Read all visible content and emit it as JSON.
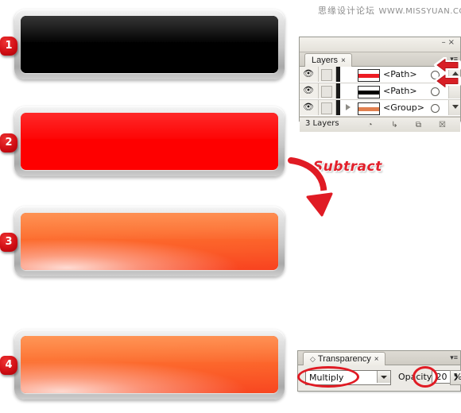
{
  "watermark": {
    "cn": "思缘设计论坛",
    "en": "WWW.MISSYUAN.COM"
  },
  "annotations": {
    "subtract_label": "Subtract",
    "subtract_arrow_icon": "curved-arrow-icon",
    "layer_pointer_icon": "left-arrow-icon"
  },
  "steps": [
    {
      "badge": "1",
      "name": "black-button",
      "fill": "#000000",
      "description": "black rounded button with silver bezel"
    },
    {
      "badge": "2",
      "name": "red-button",
      "fill": "#FE0000",
      "description": "pure red rounded button with silver bezel"
    },
    {
      "badge": "3",
      "name": "orange-button",
      "fill": "#FB5527",
      "description": "orange to red gradient button with bottom-left glow"
    },
    {
      "badge": "4",
      "name": "orange-button-multiply",
      "fill": "#FB5D28",
      "description": "orange button after multiply blend at 20% opacity"
    }
  ],
  "layers_panel": {
    "tab_label": "Layers",
    "tab_close": "×",
    "window_minimize": "–",
    "window_close": "×",
    "menu_icon": "panel-menu-icon",
    "footer_count": "3 Layers",
    "footer_buttons": [
      {
        "name": "make-clipping-mask-button",
        "glyph": "◔"
      },
      {
        "name": "create-new-sublayer-button",
        "glyph": "↳"
      },
      {
        "name": "create-new-layer-button",
        "glyph": "⧉"
      },
      {
        "name": "delete-selection-button",
        "glyph": "☒"
      }
    ],
    "rows": [
      {
        "label": "<Path>",
        "thumb_color": "#ED1C24",
        "expandable": false,
        "visible": true,
        "locked": false
      },
      {
        "label": "<Path>",
        "thumb_color": "#000000",
        "expandable": false,
        "visible": true,
        "locked": false
      },
      {
        "label": "<Group>",
        "thumb_color": "#E08050",
        "expandable": true,
        "visible": true,
        "locked": false
      }
    ]
  },
  "transparency_panel": {
    "tab_label": "Transparency",
    "tab_close": "×",
    "tab_grip_icon": "panel-grip-icon",
    "menu_icon": "panel-menu-icon",
    "window_minimize": "–",
    "window_close": "×",
    "blend_mode": "Multiply",
    "opacity_label": "Opacity:",
    "opacity_value": "20",
    "percent_sign": "%",
    "stepper_glyph": "❯"
  },
  "colors": {
    "accent_red": "#E01B24",
    "badge_red": "#D10F15",
    "bezel_light": "#F5F5F5",
    "bezel_dark": "#A9A9A9"
  }
}
